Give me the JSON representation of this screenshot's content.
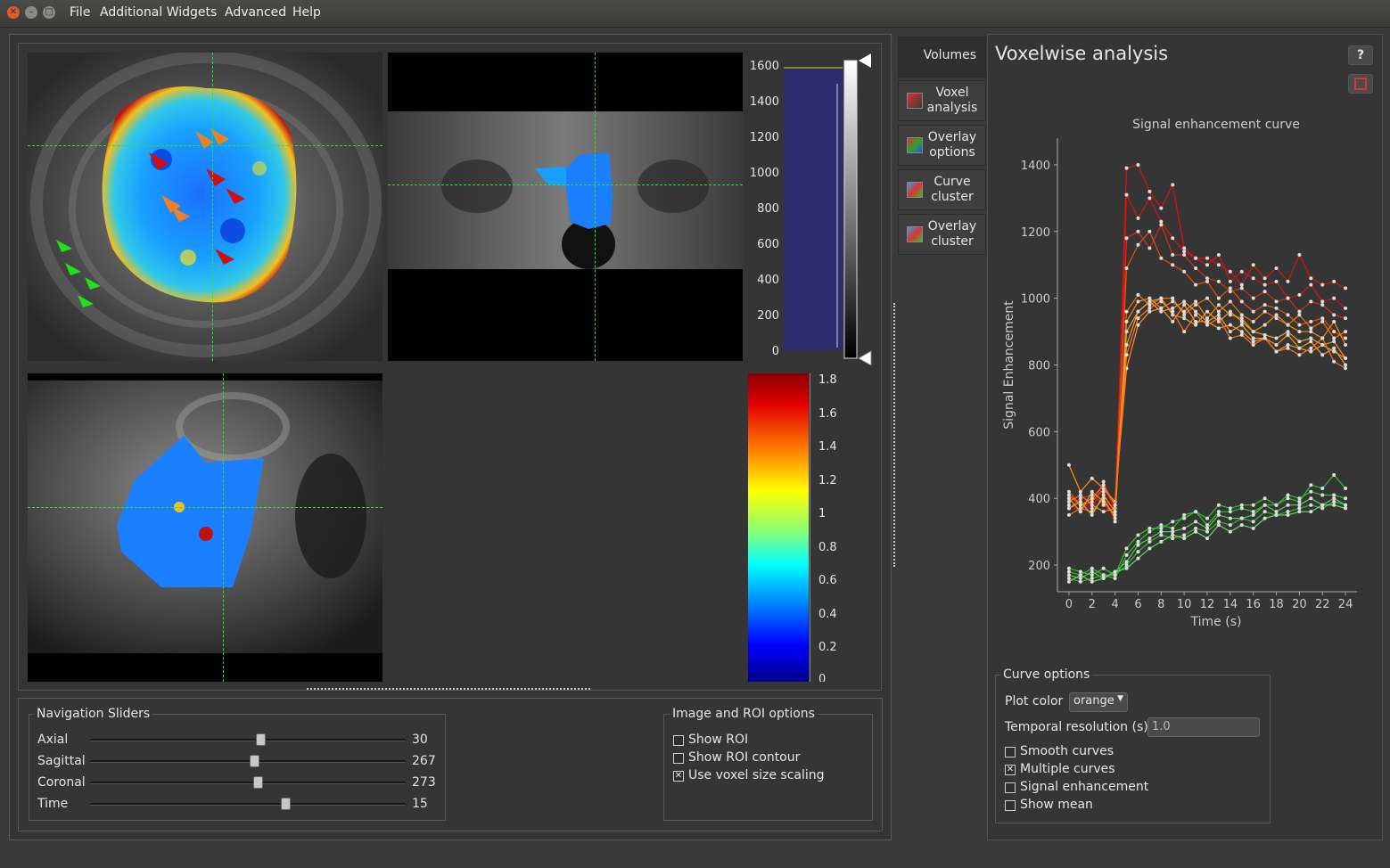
{
  "menu": {
    "items": [
      "File",
      "Additional Widgets",
      "Advanced",
      "Help"
    ]
  },
  "histogram": {
    "ticks": [
      "1600",
      "1400",
      "1200",
      "1000",
      "800",
      "600",
      "400",
      "200",
      "0"
    ]
  },
  "colorbar": {
    "ticks": [
      "1.8",
      "1.6",
      "1.4",
      "1.2",
      "1",
      "0.8",
      "0.6",
      "0.4",
      "0.2",
      "0"
    ]
  },
  "navigation": {
    "title": "Navigation Sliders",
    "sliders": [
      {
        "label": "Axial",
        "value": "30",
        "fraction": 0.54
      },
      {
        "label": "Sagittal",
        "value": "267",
        "fraction": 0.52
      },
      {
        "label": "Coronal",
        "value": "273",
        "fraction": 0.53
      },
      {
        "label": "Time",
        "value": "15",
        "fraction": 0.62
      }
    ]
  },
  "image_roi": {
    "title": "Image and ROI options",
    "options": [
      {
        "label": "Show ROI",
        "checked": false
      },
      {
        "label": "Show ROI contour",
        "checked": false
      },
      {
        "label": "Use voxel size scaling",
        "checked": true
      }
    ]
  },
  "tabs": {
    "header": "Volumes",
    "items": [
      {
        "label": "Voxel analysis",
        "icon": "voxel-analysis-icon"
      },
      {
        "label": "Overlay options",
        "icon": "overlay-options-icon"
      },
      {
        "label": "Curve cluster",
        "icon": "curve-cluster-icon"
      },
      {
        "label": "Overlay cluster",
        "icon": "overlay-cluster-icon"
      }
    ]
  },
  "analysis": {
    "title": "Voxelwise analysis",
    "help_label": "?",
    "curve_options": {
      "title": "Curve options",
      "plot_color_label": "Plot color",
      "plot_color_value": "orange",
      "temporal_label": "Temporal resolution (s)",
      "temporal_value": "1.0",
      "checks": [
        {
          "label": "Smooth curves",
          "checked": false
        },
        {
          "label": "Multiple curves",
          "checked": true
        },
        {
          "label": "Signal enhancement",
          "checked": false
        },
        {
          "label": "Show mean",
          "checked": false
        }
      ]
    }
  },
  "chart_data": {
    "type": "line",
    "title": "Signal enhancement curve",
    "xlabel": "Time (s)",
    "ylabel": "Signal Enhancement",
    "xlim": [
      -1,
      25
    ],
    "ylim": [
      120,
      1480
    ],
    "xticks": [
      "0",
      "2",
      "4",
      "6",
      "8",
      "10",
      "12",
      "14",
      "16",
      "18",
      "20",
      "22",
      "24"
    ],
    "yticks": [
      "200",
      "400",
      "600",
      "800",
      "1000",
      "1200",
      "1400"
    ],
    "x": [
      0,
      1,
      2,
      3,
      4,
      5,
      6,
      7,
      8,
      9,
      10,
      11,
      12,
      13,
      14,
      15,
      16,
      17,
      18,
      19,
      20,
      21,
      22,
      23,
      24
    ],
    "series": [
      {
        "color": "#e01010",
        "values": [
          380,
          360,
          400,
          420,
          330,
          1390,
          1400,
          1320,
          1270,
          1340,
          1150,
          1120,
          1120,
          1100,
          1080,
          1040,
          1100,
          1060,
          1090,
          1050,
          1130,
          1060,
          1040,
          1050,
          1030
        ]
      },
      {
        "color": "#e01010",
        "values": [
          400,
          390,
          370,
          450,
          360,
          1310,
          1240,
          1300,
          1230,
          1180,
          1140,
          1120,
          1100,
          1130,
          1050,
          1080,
          1060,
          1040,
          1050,
          1000,
          1010,
          1040,
          990,
          1000,
          970
        ]
      },
      {
        "color": "#d83010",
        "values": [
          370,
          400,
          410,
          380,
          350,
          1180,
          1200,
          1150,
          1220,
          1130,
          1130,
          1090,
          1060,
          1050,
          1020,
          1030,
          1000,
          1020,
          990,
          1000,
          960,
          990,
          980,
          950,
          940
        ]
      },
      {
        "color": "#e85010",
        "values": [
          420,
          380,
          390,
          430,
          380,
          1090,
          1160,
          1200,
          1120,
          1100,
          1080,
          1040,
          1050,
          1000,
          1030,
          990,
          960,
          980,
          970,
          950,
          920,
          930,
          940,
          900,
          880
        ]
      },
      {
        "color": "#f07010",
        "values": [
          350,
          370,
          360,
          400,
          340,
          960,
          1010,
          980,
          1000,
          1000,
          950,
          980,
          1000,
          960,
          990,
          950,
          930,
          960,
          940,
          920,
          950,
          910,
          930,
          880,
          900
        ]
      },
      {
        "color": "#f08a10",
        "values": [
          390,
          410,
          380,
          360,
          370,
          930,
          990,
          1000,
          970,
          990,
          960,
          990,
          940,
          980,
          950,
          940,
          900,
          920,
          950,
          920,
          900,
          900,
          880,
          930,
          860
        ]
      },
      {
        "color": "#f0a020",
        "values": [
          400,
          360,
          420,
          390,
          350,
          900,
          960,
          990,
          1000,
          950,
          940,
          920,
          960,
          930,
          960,
          930,
          900,
          890,
          880,
          900,
          870,
          880,
          860,
          840,
          820
        ]
      },
      {
        "color": "#f0a020",
        "values": [
          370,
          390,
          350,
          410,
          360,
          860,
          960,
          990,
          960,
          970,
          990,
          960,
          930,
          950,
          900,
          920,
          880,
          880,
          840,
          860,
          850,
          870,
          830,
          850,
          800
        ]
      },
      {
        "color": "#ff9020",
        "values": [
          500,
          420,
          460,
          430,
          390,
          790,
          920,
          960,
          970,
          930,
          980,
          930,
          930,
          910,
          920,
          900,
          870,
          880,
          860,
          890,
          850,
          840,
          860,
          870,
          820
        ]
      },
      {
        "color": "#ff7020",
        "values": [
          410,
          380,
          400,
          440,
          380,
          830,
          940,
          970,
          990,
          960,
          900,
          950,
          920,
          940,
          880,
          890,
          860,
          880,
          840,
          850,
          830,
          850,
          880,
          810,
          790
        ]
      },
      {
        "color": "#30c030",
        "values": [
          190,
          180,
          170,
          190,
          170,
          250,
          290,
          310,
          310,
          330,
          340,
          360,
          320,
          360,
          360,
          370,
          360,
          380,
          380,
          400,
          390,
          440,
          430,
          470,
          430
        ]
      },
      {
        "color": "#30c030",
        "values": [
          180,
          170,
          190,
          170,
          160,
          230,
          270,
          300,
          320,
          310,
          350,
          360,
          340,
          380,
          370,
          380,
          380,
          400,
          380,
          410,
          400,
          420,
          410,
          410,
          400
        ]
      },
      {
        "color": "#50d050",
        "values": [
          170,
          160,
          180,
          160,
          180,
          210,
          260,
          280,
          300,
          300,
          310,
          330,
          310,
          350,
          340,
          340,
          350,
          380,
          360,
          380,
          380,
          400,
          380,
          400,
          380
        ]
      },
      {
        "color": "#40b040",
        "values": [
          160,
          150,
          160,
          170,
          170,
          200,
          240,
          270,
          290,
          280,
          290,
          310,
          300,
          330,
          320,
          340,
          330,
          360,
          350,
          360,
          370,
          380,
          370,
          390,
          380
        ]
      },
      {
        "color": "#60e060",
        "values": [
          150,
          170,
          150,
          160,
          180,
          190,
          220,
          250,
          270,
          290,
          280,
          300,
          280,
          320,
          300,
          320,
          310,
          340,
          350,
          350,
          360,
          360,
          380,
          380,
          370
        ]
      }
    ]
  }
}
